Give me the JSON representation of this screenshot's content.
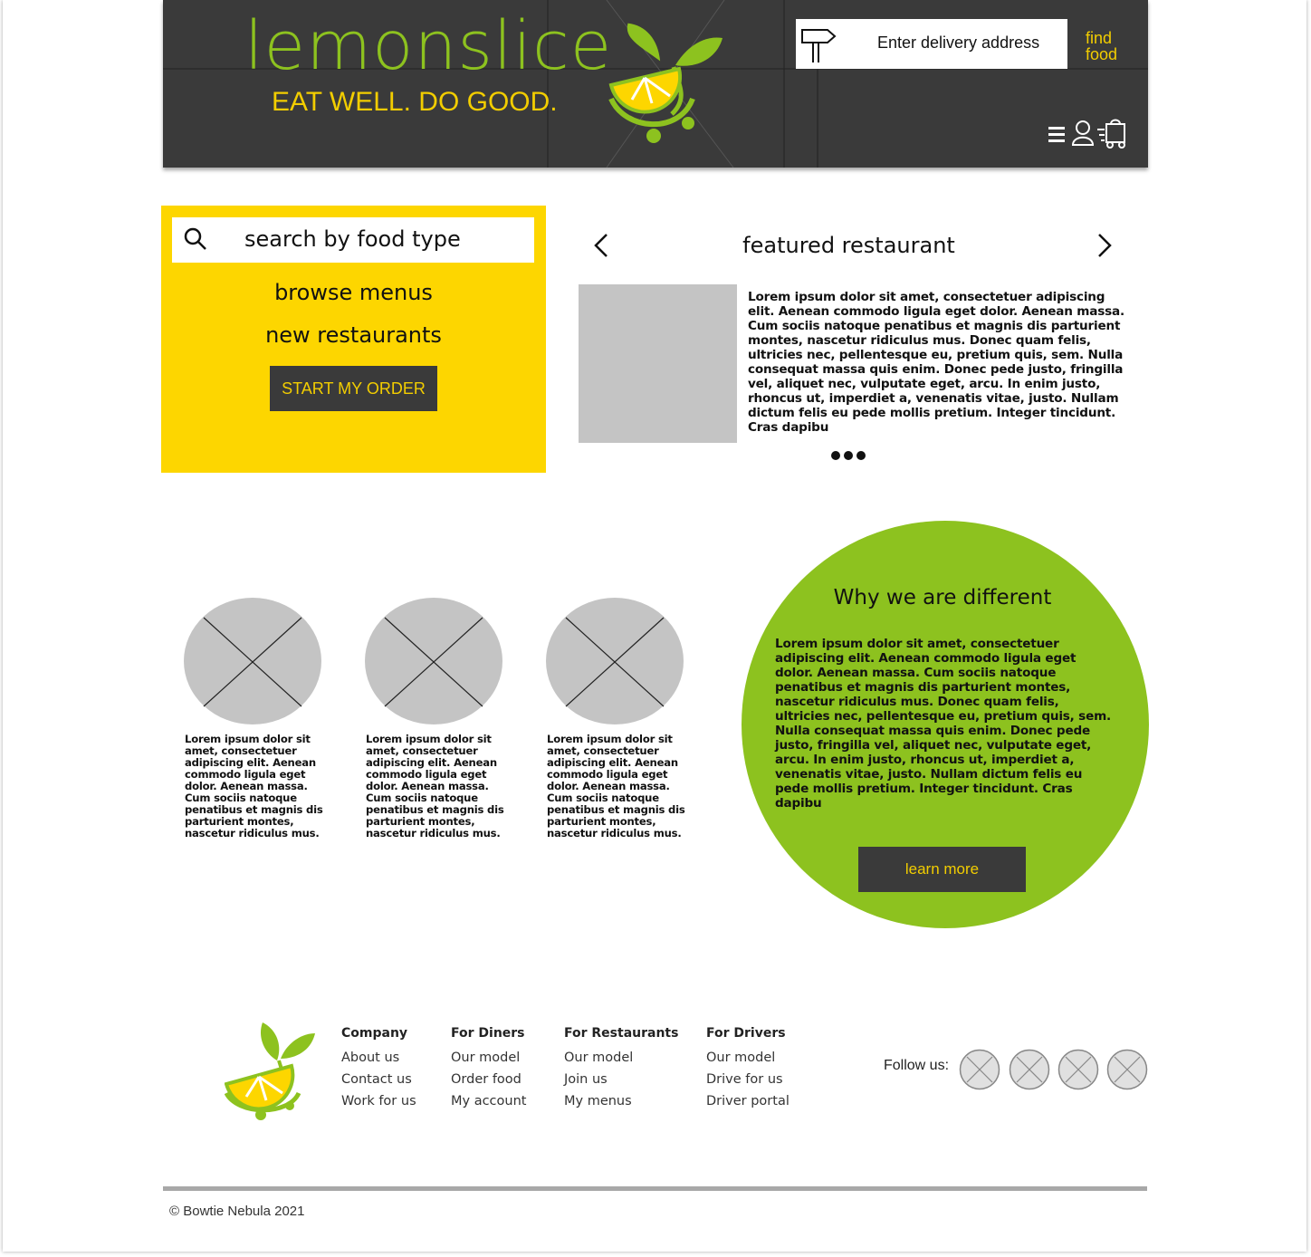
{
  "header": {
    "brand": "lemonslice",
    "tagline": "EAT WELL. DO GOOD.",
    "address_label": "Enter delivery address",
    "find_food": "find food",
    "icons": [
      "menu-icon",
      "user-icon",
      "cart-icon"
    ]
  },
  "hero": {
    "search_placeholder": "search by food type",
    "links": [
      "browse menus",
      "new restaurants"
    ],
    "cta": "START MY ORDER"
  },
  "featured": {
    "title": "featured restaurant",
    "description": "Lorem ipsum dolor sit amet, consectetuer adipiscing elit. Aenean commodo ligula eget dolor. Aenean massa. Cum sociis natoque penatibus et magnis dis parturient montes, nascetur ridiculus mus. Donec quam felis, ultricies nec, pellentesque eu, pretium quis, sem. Nulla consequat massa quis enim. Donec pede justo, fringilla vel, aliquet nec, vulputate eget, arcu. In enim justo, rhoncus ut, imperdiet a, venenatis vitae, justo. Nullam dictum felis eu pede mollis pretium. Integer tincidunt. Cras dapibu"
  },
  "features": [
    {
      "text": "Lorem ipsum dolor sit amet, consectetuer adipiscing elit. Aenean commodo ligula eget dolor. Aenean massa. Cum sociis natoque penatibus et magnis dis parturient montes, nascetur ridiculus mus."
    },
    {
      "text": "Lorem ipsum dolor sit amet, consectetuer adipiscing elit. Aenean commodo ligula eget dolor. Aenean massa. Cum sociis natoque penatibus et magnis dis parturient montes, nascetur ridiculus mus."
    },
    {
      "text": "Lorem ipsum dolor sit amet, consectetuer adipiscing elit. Aenean commodo ligula eget dolor. Aenean massa. Cum sociis natoque penatibus et magnis dis parturient montes, nascetur ridiculus mus."
    }
  ],
  "why": {
    "title": "Why we are different",
    "text": "Lorem ipsum dolor sit amet, consectetuer adipiscing elit. Aenean commodo ligula eget dolor. Aenean massa. Cum sociis natoque penatibus et magnis dis parturient montes, nascetur ridiculus mus. Donec quam felis, ultricies nec, pellentesque eu, pretium quis, sem. Nulla consequat massa quis enim. Donec pede justo, fringilla vel, aliquet nec, vulputate eget, arcu. In enim justo, rhoncus ut, imperdiet a, venenatis vitae, justo. Nullam dictum felis eu pede mollis pretium. Integer tincidunt. Cras dapibu",
    "button": "learn more"
  },
  "footer": {
    "columns": [
      {
        "heading": "Company",
        "items": [
          "About us",
          "Contact us",
          "Work for us"
        ]
      },
      {
        "heading": "For Diners",
        "items": [
          "Our model",
          "Order food",
          "My account"
        ]
      },
      {
        "heading": "For Restaurants",
        "items": [
          "Our model",
          "Join us",
          "My menus"
        ]
      },
      {
        "heading": "For Drivers",
        "items": [
          "Our model",
          "Drive for us",
          "Driver portal"
        ]
      }
    ],
    "follow_label": "Follow us:",
    "copyright": "© Bowtie Nebula 2021"
  },
  "colors": {
    "dark": "#3a3a3a",
    "green": "#8dc21f",
    "yellow": "#fdd600",
    "accent_text": "#f2cd00",
    "placeholder": "#c4c4c4"
  }
}
